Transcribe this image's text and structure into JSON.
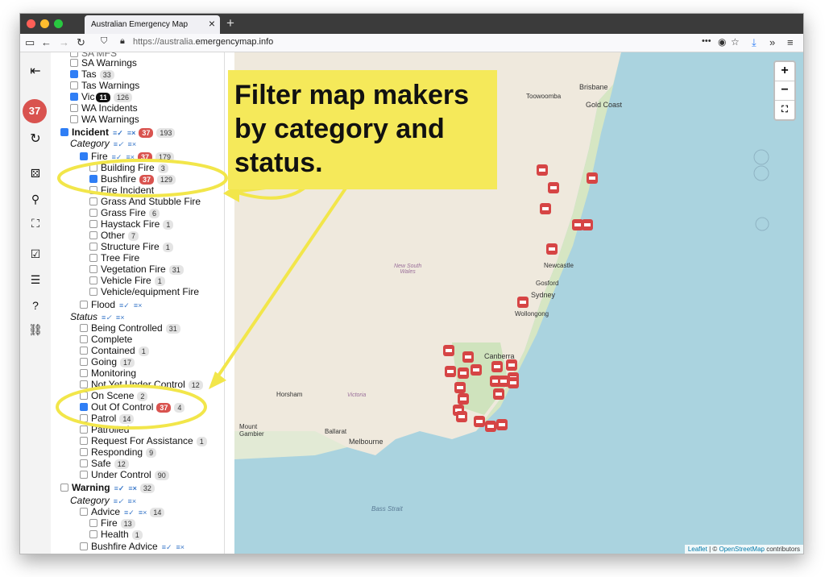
{
  "browser": {
    "tab_title": "Australian Emergency Map",
    "url_prefix": "https://australia.",
    "url_domain": "emergencymap.info"
  },
  "rail": {
    "badge": "37"
  },
  "sidebar": {
    "sa_warnings": "SA Warnings",
    "tas": "Tas",
    "tas_count": "33",
    "tas_warnings": "Tas Warnings",
    "vic": "Vic",
    "vic_badge": "11",
    "vic_count": "126",
    "wa_incidents": "WA Incidents",
    "wa_warnings": "WA Warnings",
    "incident": "Incident",
    "incident_badge": "37",
    "incident_count": "193",
    "category": "Category",
    "fire": "Fire",
    "fire_badge": "37",
    "fire_count": "179",
    "building_fire": "Building Fire",
    "building_fire_count": "3",
    "bushfire": "Bushfire",
    "bushfire_badge": "37",
    "bushfire_count": "129",
    "fire_incident": "Fire Incident",
    "grass_stubble": "Grass And Stubble Fire",
    "grass_fire": "Grass Fire",
    "grass_fire_count": "6",
    "haystack": "Haystack Fire",
    "haystack_count": "1",
    "other": "Other",
    "other_count": "7",
    "structure": "Structure Fire",
    "structure_count": "1",
    "tree": "Tree Fire",
    "vegetation": "Vegetation Fire",
    "vegetation_count": "31",
    "vehicle": "Vehicle Fire",
    "vehicle_count": "1",
    "vehicle_equipment": "Vehicle/equipment Fire",
    "flood": "Flood",
    "status": "Status",
    "being_controlled": "Being Controlled",
    "being_controlled_count": "31",
    "complete": "Complete",
    "contained": "Contained",
    "contained_count": "1",
    "going": "Going",
    "going_count": "17",
    "monitoring": "Monitoring",
    "not_yet": "Not Yet Under Control",
    "not_yet_count": "12",
    "on_scene": "On Scene",
    "on_scene_count": "2",
    "out_of_control": "Out Of Control",
    "ooc_badge": "37",
    "ooc_count": "4",
    "patrol": "Patrol",
    "patrol_count": "14",
    "patrolled": "Patrolled",
    "request": "Request For Assistance",
    "request_count": "1",
    "responding": "Responding",
    "responding_count": "9",
    "safe": "Safe",
    "safe_count": "12",
    "under_control": "Under Control",
    "under_control_count": "90",
    "warning": "Warning",
    "warning_count": "32",
    "w_category": "Category",
    "advice": "Advice",
    "advice_count": "14",
    "w_fire": "Fire",
    "w_fire_count": "13",
    "health": "Health",
    "health_count": "1",
    "bushfire_advice": "Bushfire Advice"
  },
  "map": {
    "places": {
      "brisbane": "Brisbane",
      "gold_coast": "Gold Coast",
      "toowoomba": "Toowoomba",
      "newcastle": "Newcastle",
      "gosford": "Gosford",
      "sydney": "Sydney",
      "wollongong": "Wollongong",
      "canberra": "Canberra",
      "horsham": "Horsham",
      "victoria": "Victoria",
      "ballarat": "Ballarat",
      "melbourne": "Melbourne",
      "mount_gambier": "Mount\nGambier",
      "nsw": "New South\nWales",
      "bass_strait": "Bass Strait"
    },
    "zoom_in": "+",
    "zoom_out": "−",
    "attribution_leaflet": "Leaflet",
    "attribution_sep": " | © ",
    "attribution_osm": "OpenStreetMap",
    "attribution_tail": " contributors",
    "marker_color": "#d64545"
  },
  "callout": {
    "text": "Filter map makers by category and status."
  }
}
